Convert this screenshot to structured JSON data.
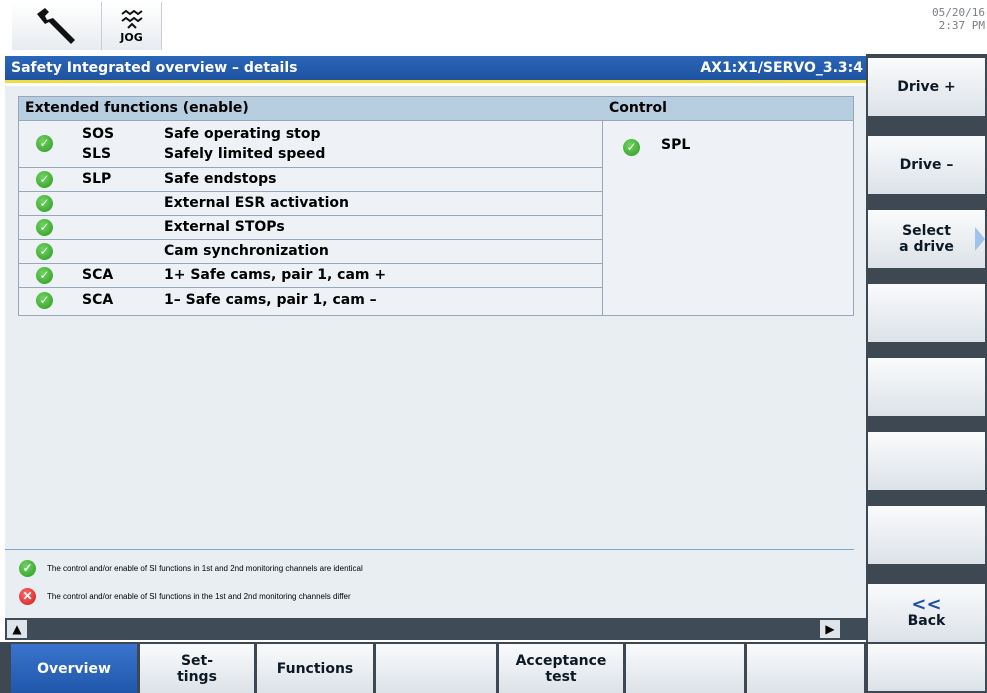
{
  "header": {
    "tool_icon": "wrench-icon",
    "mode_icon": "jog-wave-icon",
    "mode_label": "JOG",
    "date": "05/20/16",
    "time": "2:37 PM"
  },
  "titlebar": {
    "title": "Safety Integrated overview – details",
    "drive_path": "AX1:X1/SERVO_3.3:4"
  },
  "table": {
    "ext_header": "Extended functions (enable)",
    "control_header": "Control",
    "rows": [
      {
        "abbr": "SOS\nSLS",
        "desc": "Safe operating stop\nSafely limited speed",
        "status": "ok"
      },
      {
        "abbr": "SLP",
        "desc": "Safe endstops",
        "status": "ok"
      },
      {
        "abbr": "",
        "desc": "External ESR activation",
        "status": "ok"
      },
      {
        "abbr": "",
        "desc": "External STOPs",
        "status": "ok"
      },
      {
        "abbr": "",
        "desc": "Cam synchronization",
        "status": "ok"
      },
      {
        "abbr": "SCA",
        "desc": "1+ Safe cams, pair 1, cam +",
        "status": "ok"
      },
      {
        "abbr": "SCA",
        "desc": "1– Safe cams, pair 1, cam –",
        "status": "ok"
      }
    ],
    "control_items": [
      {
        "label": "SPL",
        "status": "ok"
      }
    ]
  },
  "legend": {
    "identical": "The control and/or enable of SI functions in 1st and 2nd monitoring channels are identical",
    "differ": "The control and/or enable of SI functions in the 1st and 2nd monitoring channels differ"
  },
  "softkeys_right": {
    "drive_plus": "Drive +",
    "drive_minus": "Drive –",
    "select_drive_1": "Select",
    "select_drive_2": "a drive",
    "back_arrow": "<<",
    "back": "Back"
  },
  "softkeys_bottom": {
    "overview": "Overview",
    "settings_1": "Set-",
    "settings_2": "tings",
    "functions": "Functions",
    "acceptance_1": "Acceptance",
    "acceptance_2": "test"
  },
  "colors": {
    "title_blue": "#1f52a0",
    "header_cell": "#b7cde0",
    "ok_green": "#2c9a23",
    "error_red": "#d01a1a",
    "accent_yellow": "#f0dc3c"
  }
}
